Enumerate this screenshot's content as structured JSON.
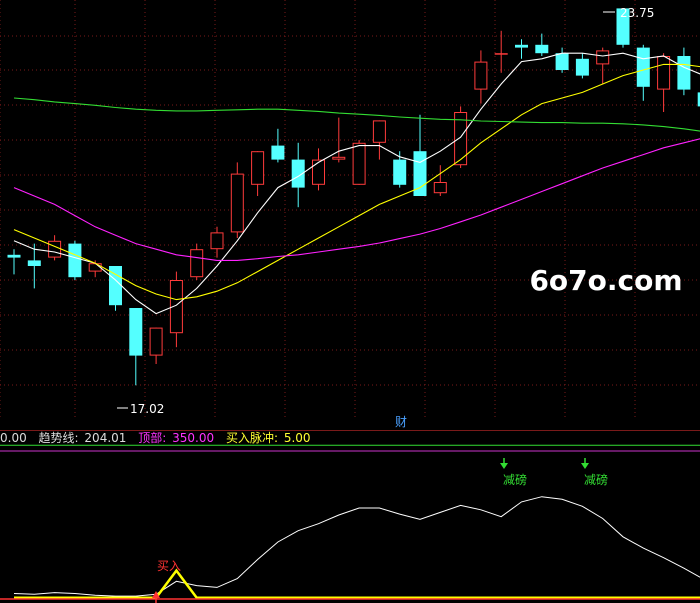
{
  "colors": {
    "background": "#000000",
    "grid": "#7a1a1a",
    "up": "#ff3b3b",
    "down": "#54ffff",
    "ma_short": "#ffffff",
    "ma_mid": "#ffff00",
    "ma_long": "#ff22ff",
    "ma_xlong": "#33dd33",
    "signal_text": "#33dd33",
    "buy_text": "#ff3333"
  },
  "annotations": {
    "high_label": "23.75",
    "low_label": "17.02",
    "finance_marker": "财",
    "watermark": "6o7o.com"
  },
  "indicator_header": {
    "prefix_value": "0.00",
    "trend_label": "趋势线:",
    "trend_value": "204.01",
    "top_label": "顶部:",
    "top_value": "350.00",
    "buy_pulse_label": "买入脉冲:",
    "buy_pulse_value": "5.00"
  },
  "signals": {
    "reduce_1": "减磅",
    "reduce_2": "减磅",
    "buy": "买入"
  },
  "chart_data": [
    {
      "type": "candlestick",
      "title": "",
      "xlabel": "",
      "ylabel": "",
      "ylim": [
        16.4,
        23.9
      ],
      "candles": [
        {
          "o": 19.35,
          "h": 19.45,
          "l": 19.0,
          "c": 19.3
        },
        {
          "o": 19.25,
          "h": 19.55,
          "l": 18.75,
          "c": 19.15
        },
        {
          "o": 19.3,
          "h": 19.7,
          "l": 19.25,
          "c": 19.6
        },
        {
          "o": 19.55,
          "h": 19.6,
          "l": 18.9,
          "c": 18.95
        },
        {
          "o": 19.05,
          "h": 19.25,
          "l": 18.95,
          "c": 19.2
        },
        {
          "o": 19.15,
          "h": 19.15,
          "l": 18.35,
          "c": 18.45
        },
        {
          "o": 18.4,
          "h": 18.4,
          "l": 17.02,
          "c": 17.55
        },
        {
          "o": 17.55,
          "h": 18.05,
          "l": 17.4,
          "c": 18.05
        },
        {
          "o": 17.95,
          "h": 19.05,
          "l": 17.7,
          "c": 18.9
        },
        {
          "o": 18.95,
          "h": 19.55,
          "l": 18.9,
          "c": 19.45
        },
        {
          "o": 19.45,
          "h": 19.85,
          "l": 19.3,
          "c": 19.75
        },
        {
          "o": 19.75,
          "h": 21.0,
          "l": 19.65,
          "c": 20.8
        },
        {
          "o": 20.6,
          "h": 21.2,
          "l": 20.4,
          "c": 21.2
        },
        {
          "o": 21.3,
          "h": 21.6,
          "l": 21.0,
          "c": 21.05
        },
        {
          "o": 21.05,
          "h": 21.35,
          "l": 20.2,
          "c": 20.55
        },
        {
          "o": 20.6,
          "h": 21.25,
          "l": 20.5,
          "c": 21.05
        },
        {
          "o": 21.05,
          "h": 21.8,
          "l": 21.0,
          "c": 21.1
        },
        {
          "o": 20.6,
          "h": 21.4,
          "l": 20.6,
          "c": 21.35
        },
        {
          "o": 21.35,
          "h": 21.75,
          "l": 21.05,
          "c": 21.75
        },
        {
          "o": 21.05,
          "h": 21.2,
          "l": 20.55,
          "c": 20.6
        },
        {
          "o": 21.2,
          "h": 21.85,
          "l": 20.4,
          "c": 20.4
        },
        {
          "o": 20.45,
          "h": 20.95,
          "l": 20.4,
          "c": 20.65
        },
        {
          "o": 20.95,
          "h": 22.0,
          "l": 20.9,
          "c": 21.9
        },
        {
          "o": 22.3,
          "h": 23.0,
          "l": 22.05,
          "c": 22.8
        },
        {
          "o": 22.95,
          "h": 23.35,
          "l": 22.6,
          "c": 22.95
        },
        {
          "o": 23.1,
          "h": 23.2,
          "l": 22.85,
          "c": 23.05
        },
        {
          "o": 23.1,
          "h": 23.3,
          "l": 22.9,
          "c": 22.95
        },
        {
          "o": 22.95,
          "h": 23.05,
          "l": 22.6,
          "c": 22.65
        },
        {
          "o": 22.85,
          "h": 22.95,
          "l": 22.5,
          "c": 22.55
        },
        {
          "o": 22.75,
          "h": 23.05,
          "l": 22.4,
          "c": 23.0
        },
        {
          "o": 23.75,
          "h": 23.75,
          "l": 23.05,
          "c": 23.1
        },
        {
          "o": 23.05,
          "h": 23.1,
          "l": 22.1,
          "c": 22.35
        },
        {
          "o": 22.3,
          "h": 22.95,
          "l": 21.9,
          "c": 22.9
        },
        {
          "o": 22.9,
          "h": 23.05,
          "l": 22.2,
          "c": 22.3
        },
        {
          "o": 22.25,
          "h": 22.3,
          "l": 21.75,
          "c": 22.0
        }
      ],
      "series": [
        {
          "values": [
            19.6,
            19.45,
            19.4,
            19.3,
            19.2,
            18.9,
            18.55,
            18.3,
            18.45,
            18.75,
            19.15,
            19.6,
            20.1,
            20.55,
            20.75,
            21.0,
            21.2,
            21.3,
            21.3,
            21.1,
            21.0,
            21.2,
            21.45,
            21.95,
            22.4,
            22.8,
            22.85,
            22.95,
            22.95,
            22.9,
            22.95,
            22.85,
            22.9,
            22.7,
            22.55
          ]
        },
        {
          "values": [
            19.8,
            19.65,
            19.5,
            19.35,
            19.2,
            19.0,
            18.8,
            18.65,
            18.55,
            18.6,
            18.7,
            18.85,
            19.05,
            19.25,
            19.45,
            19.65,
            19.85,
            20.05,
            20.25,
            20.4,
            20.55,
            20.8,
            21.05,
            21.35,
            21.6,
            21.85,
            22.05,
            22.15,
            22.25,
            22.4,
            22.55,
            22.65,
            22.75,
            22.75,
            22.7
          ]
        },
        {
          "values": [
            20.55,
            20.4,
            20.25,
            20.05,
            19.85,
            19.7,
            19.55,
            19.45,
            19.35,
            19.3,
            19.25,
            19.25,
            19.28,
            19.32,
            19.35,
            19.4,
            19.45,
            19.5,
            19.56,
            19.64,
            19.72,
            19.82,
            19.94,
            20.06,
            20.2,
            20.34,
            20.48,
            20.62,
            20.76,
            20.9,
            21.02,
            21.14,
            21.26,
            21.35,
            21.44
          ]
        },
        {
          "values": [
            22.15,
            22.12,
            22.08,
            22.05,
            22.02,
            21.98,
            21.95,
            21.93,
            21.92,
            21.92,
            21.93,
            21.94,
            21.95,
            21.95,
            21.93,
            21.91,
            21.88,
            21.86,
            21.84,
            21.81,
            21.79,
            21.77,
            21.76,
            21.74,
            21.73,
            21.72,
            21.71,
            21.71,
            21.7,
            21.7,
            21.69,
            21.67,
            21.64,
            21.6,
            21.55
          ]
        }
      ]
    },
    {
      "type": "line",
      "title": "",
      "xlabel": "",
      "ylabel": "",
      "ylim": [
        -5,
        385
      ],
      "series": [
        {
          "values": [
            10,
            8,
            12,
            10,
            6,
            4,
            4,
            8,
            38,
            28,
            24,
            44,
            88,
            128,
            154,
            170,
            190,
            206,
            206,
            192,
            180,
            196,
            212,
            202,
            186,
            220,
            232,
            226,
            210,
            182,
            140,
            114,
            92,
            68,
            42
          ]
        },
        {
          "values": [
            0,
            0,
            0,
            0,
            0,
            0,
            0,
            0,
            5,
            0,
            0,
            0,
            0,
            0,
            0,
            0,
            0,
            0,
            0,
            0,
            0,
            0,
            0,
            0,
            0,
            0,
            0,
            0,
            0,
            0,
            0,
            0,
            0,
            0,
            0
          ]
        }
      ],
      "reference_lines": [
        350
      ]
    }
  ]
}
